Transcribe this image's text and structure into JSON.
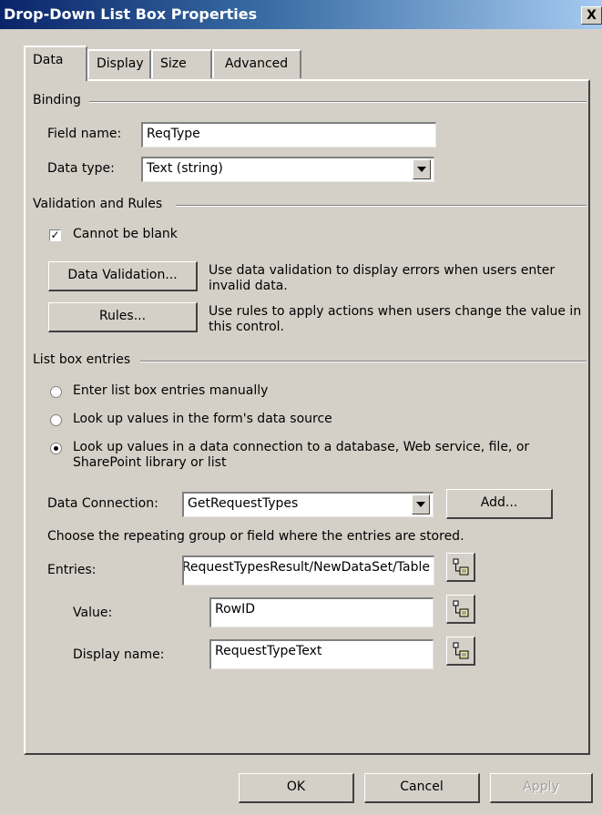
{
  "window": {
    "title": "Drop-Down List Box Properties",
    "close_glyph": "X"
  },
  "tabs": [
    {
      "label": "Data",
      "active": true
    },
    {
      "label": "Display",
      "active": false
    },
    {
      "label": "Size",
      "active": false
    },
    {
      "label": "Advanced",
      "active": false
    }
  ],
  "binding": {
    "section_label": "Binding",
    "field_name_label": "Field name:",
    "field_name_value": "ReqType",
    "data_type_label": "Data type:",
    "data_type_value": "Text (string)"
  },
  "validation": {
    "section_label": "Validation and Rules",
    "cannot_be_blank_label": "Cannot be blank",
    "cannot_be_blank_checked": true,
    "data_validation_button": "Data Validation...",
    "data_validation_desc": "Use data validation to display errors when users enter invalid data.",
    "rules_button": "Rules...",
    "rules_desc": "Use rules to apply actions when users change the value in this control."
  },
  "list_entries": {
    "section_label": "List box entries",
    "options": [
      {
        "label": "Enter list box entries manually",
        "selected": false
      },
      {
        "label": "Look up values in the form's data source",
        "selected": false
      },
      {
        "label": "Look up values in a data connection to a database, Web service, file, or SharePoint library or list",
        "selected": true
      }
    ],
    "data_connection_label": "Data Connection:",
    "data_connection_value": "GetRequestTypes",
    "add_button": "Add...",
    "repeating_group_hint": "Choose the repeating group or field where the entries are stored.",
    "entries_label": "Entries:",
    "entries_value": "/dfs:myFields/dfs:dataFields/tns:GetRequestTypesResponse/tns:GetRequestTypesResult/NewDataSet/Table",
    "value_label": "Value:",
    "value_value": "RowID",
    "display_name_label": "Display name:",
    "display_name_value": "RequestTypeText"
  },
  "footer": {
    "ok": "OK",
    "cancel": "Cancel",
    "apply": "Apply"
  }
}
